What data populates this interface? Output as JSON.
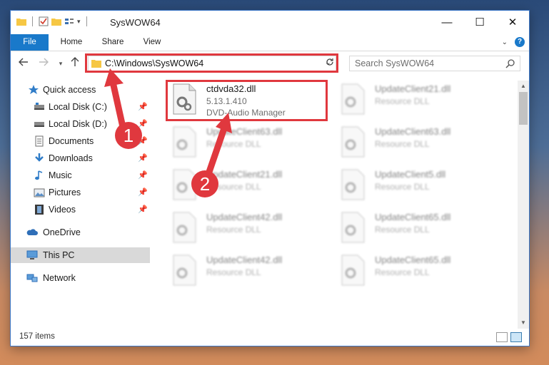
{
  "window": {
    "title": "SysWOW64",
    "controls": {
      "minimize": "—",
      "maximize": "☐",
      "close": "✕"
    }
  },
  "ribbon": {
    "tabs": [
      "File",
      "Home",
      "Share",
      "View"
    ],
    "expand_icon": "chevron-down-icon",
    "help_label": "?"
  },
  "navigation": {
    "back_icon": "arrow-left-icon",
    "forward_icon": "arrow-right-icon",
    "recent_icon": "chevron-down-icon",
    "up_icon": "arrow-up-icon",
    "address_path": "C:\\Windows\\SysWOW64",
    "search_placeholder": "Search SysWOW64"
  },
  "sidebar": {
    "items": [
      {
        "label": "Quick access",
        "icon": "star-icon",
        "pinned": false,
        "selected": false
      },
      {
        "label": "Local Disk (C:)",
        "icon": "drive-icon",
        "pinned": true,
        "selected": false
      },
      {
        "label": "Local Disk (D:)",
        "icon": "drive-icon",
        "pinned": true,
        "selected": false
      },
      {
        "label": "Documents",
        "icon": "documents-icon",
        "pinned": true,
        "selected": false
      },
      {
        "label": "Downloads",
        "icon": "download-icon",
        "pinned": true,
        "selected": false
      },
      {
        "label": "Music",
        "icon": "music-icon",
        "pinned": true,
        "selected": false
      },
      {
        "label": "Pictures",
        "icon": "pictures-icon",
        "pinned": true,
        "selected": false
      },
      {
        "label": "Videos",
        "icon": "videos-icon",
        "pinned": true,
        "selected": false
      },
      {
        "label": "OneDrive",
        "icon": "cloud-icon",
        "pinned": false,
        "selected": false
      },
      {
        "label": "This PC",
        "icon": "computer-icon",
        "pinned": false,
        "selected": true
      },
      {
        "label": "Network",
        "icon": "network-icon",
        "pinned": false,
        "selected": false
      }
    ]
  },
  "files": [
    {
      "name": "ctdvda32.dll",
      "version": "5.13.1.410",
      "description": "DVD-Audio Manager",
      "highlighted": true
    },
    {
      "name": "UpdateClient21.dll",
      "description": "Resource DLL"
    },
    {
      "name": "UpdateClient63.dll",
      "description": "Resource DLL"
    },
    {
      "name": "UpdateClient63.dll",
      "description": "Resource DLL"
    },
    {
      "name": "UpdateClient21.dll",
      "description": "Resource DLL"
    },
    {
      "name": "UpdateClient5.dll",
      "description": "Resource DLL"
    },
    {
      "name": "UpdateClient42.dll",
      "description": "Resource DLL"
    },
    {
      "name": "UpdateClient65.dll",
      "description": "Resource DLL"
    },
    {
      "name": "UpdateClient42.dll",
      "description": "Resource DLL"
    },
    {
      "name": "UpdateClient65.dll",
      "description": "Resource DLL"
    }
  ],
  "status": {
    "item_count": "157 items"
  },
  "annotations": {
    "step1": "1",
    "step2": "2",
    "color": "#e0383e"
  }
}
